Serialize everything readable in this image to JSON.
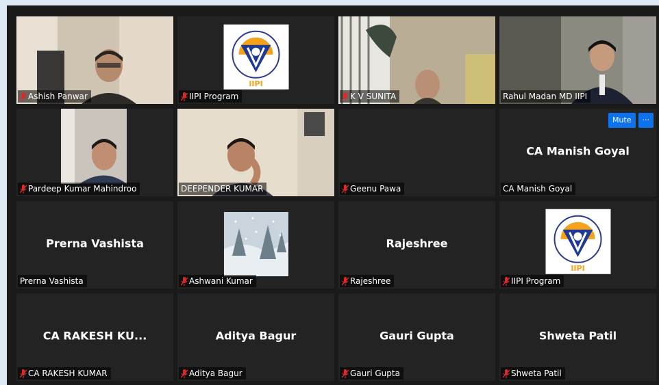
{
  "participants": [
    {
      "name": "Ashish Panwar",
      "muted": true,
      "type": "video"
    },
    {
      "name": "IIPI Program",
      "muted": true,
      "type": "logo"
    },
    {
      "name": "K V SUNITA",
      "muted": true,
      "type": "video"
    },
    {
      "name": "Rahul Madan MD IIPI",
      "muted": false,
      "type": "video",
      "active": true
    },
    {
      "name": "Pardeep Kumar Mahindroo",
      "muted": true,
      "type": "video"
    },
    {
      "name": "DEEPENDER KUMAR",
      "muted": false,
      "type": "video"
    },
    {
      "name": "Geenu Pawa",
      "muted": true,
      "type": "blank"
    },
    {
      "name": "CA Manish Goyal",
      "display": "CA Manish Goyal",
      "muted": false,
      "type": "name"
    },
    {
      "name": "Prerna Vashista",
      "display": "Prerna Vashista",
      "muted": false,
      "type": "name"
    },
    {
      "name": "Ashwani Kumar",
      "muted": true,
      "type": "image"
    },
    {
      "name": "Rajeshree",
      "display": "Rajeshree",
      "muted": true,
      "type": "name"
    },
    {
      "name": "IIPI Program",
      "muted": true,
      "type": "logo"
    },
    {
      "name": "CA RAKESH KUMAR",
      "display": "CA RAKESH KU...",
      "muted": true,
      "type": "name"
    },
    {
      "name": "Aditya Bagur",
      "display": "Aditya Bagur",
      "muted": true,
      "type": "name"
    },
    {
      "name": "Gauri Gupta",
      "display": "Gauri Gupta",
      "muted": true,
      "type": "name"
    },
    {
      "name": "Shweta Patil",
      "display": "Shweta Patil",
      "muted": true,
      "type": "name"
    }
  ],
  "hover_controls": {
    "mute_label": "Mute",
    "more_label": "···"
  },
  "logo_text": "IIPI",
  "colors": {
    "active_border": "#d8e86a",
    "muted_icon": "#e02828",
    "button": "#0e72ed"
  }
}
